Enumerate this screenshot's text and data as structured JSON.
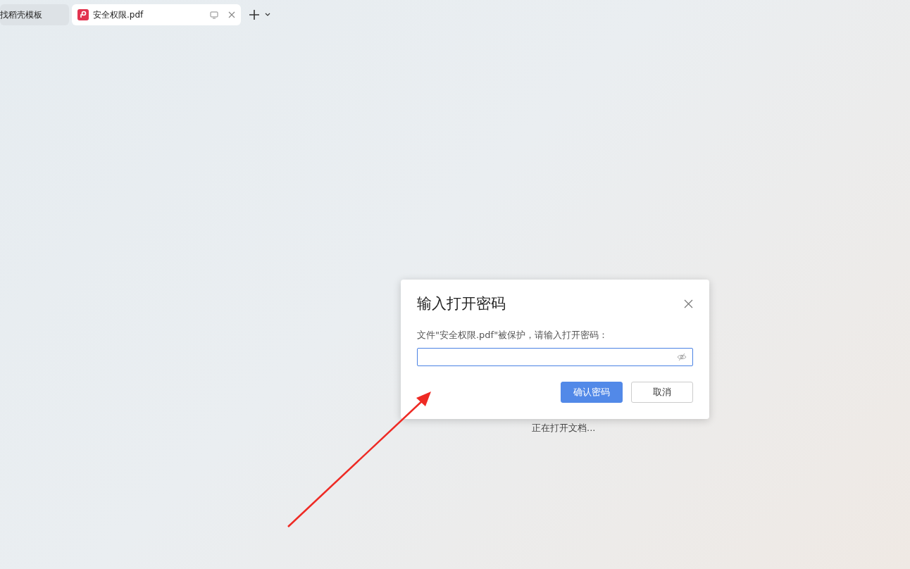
{
  "tabs": [
    {
      "label": "找稻壳模板",
      "kind": "plain",
      "selected": false
    },
    {
      "label": "安全权限.pdf",
      "kind": "pdf",
      "selected": true
    }
  ],
  "status_text": "正在打开文档...",
  "dialog": {
    "title": "输入打开密码",
    "message": "文件\"安全权限.pdf\"被保护，请输入打开密码：",
    "buttons": [
      {
        "label": "确认密码",
        "kind": "primary"
      },
      {
        "label": "取消",
        "kind": "secondary"
      }
    ]
  }
}
